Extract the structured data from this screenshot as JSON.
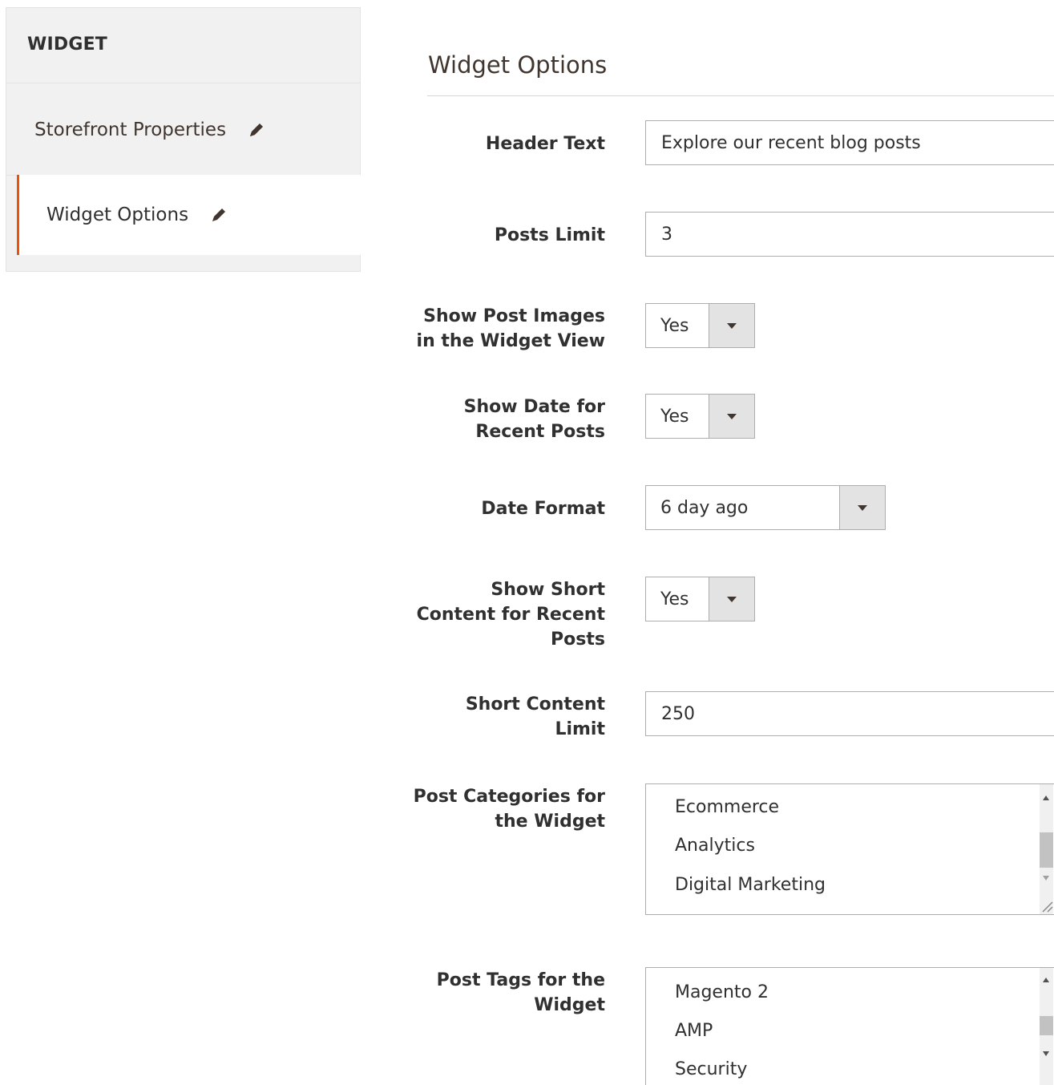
{
  "sidebar": {
    "title": "WIDGET",
    "items": [
      {
        "label": "Storefront Properties",
        "icon": "pencil-icon",
        "active": false
      },
      {
        "label": "Widget Options",
        "icon": "pencil-icon",
        "active": true
      }
    ],
    "active_color": "#eb5202"
  },
  "main": {
    "title": "Widget Options",
    "fields": {
      "header_text": {
        "label": "Header Text",
        "value": "Explore our recent blog posts"
      },
      "posts_limit": {
        "label": "Posts Limit",
        "value": "3"
      },
      "show_images": {
        "label_line1": "Show Post Images",
        "label_line2": "in the Widget View",
        "value": "Yes"
      },
      "show_date": {
        "label_line1": "Show Date for",
        "label_line2": "Recent Posts",
        "value": "Yes"
      },
      "date_format": {
        "label": "Date Format",
        "value": "6 day ago"
      },
      "show_short": {
        "label_line1": "Show Short",
        "label_line2": "Content for Recent",
        "label_line3": "Posts",
        "value": "Yes"
      },
      "short_limit": {
        "label_line1": "Short Content",
        "label_line2": "Limit",
        "value": "250"
      },
      "categories": {
        "label_line1": "Post Categories for",
        "label_line2": "the Widget",
        "options": [
          "Ecommerce",
          "Analytics",
          "Digital Marketing"
        ]
      },
      "tags": {
        "label_line1": "Post Tags for the",
        "label_line2": "Widget",
        "options": [
          "Magento 2",
          "AMP",
          "Security"
        ]
      }
    }
  }
}
